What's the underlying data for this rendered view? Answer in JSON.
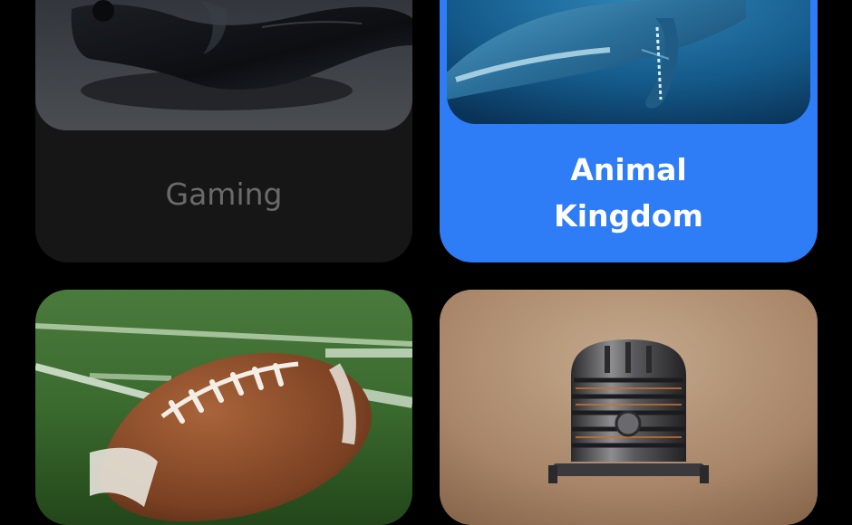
{
  "categories": [
    {
      "label": "Gaming",
      "image": "game-controller-photo",
      "selected": false
    },
    {
      "label": "Animal Kingdom",
      "image": "whale-photo",
      "selected": true
    },
    {
      "label": "",
      "image": "football-photo",
      "selected": false
    },
    {
      "label": "",
      "image": "microphone-photo",
      "selected": false
    }
  ],
  "colors": {
    "background": "#000000",
    "card_default": "#161616",
    "card_selected": "#2e7cf6",
    "label_default": "#6a6a6a",
    "label_selected": "#ffffff"
  }
}
